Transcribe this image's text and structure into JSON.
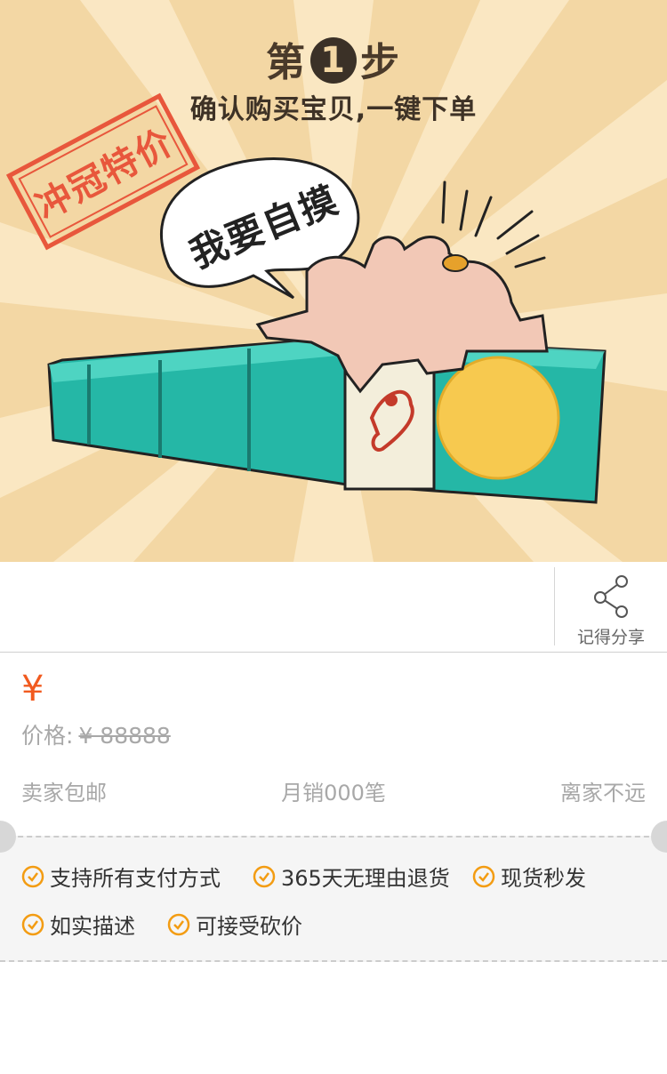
{
  "banner": {
    "step_prefix": "第",
    "step_number": "1",
    "step_suffix": "步",
    "subtitle": "确认购买宝贝,一键下单",
    "stamp_text": "冲冠特价",
    "bubble_text": "我要自摸"
  },
  "share": {
    "label": "记得分享",
    "icon": "share-icon"
  },
  "price": {
    "currency_symbol": "¥",
    "original_label": "价格:",
    "original_value": "¥ 88888"
  },
  "meta": {
    "shipping": "卖家包邮",
    "monthly_sales": "月销000笔",
    "distance": "离家不远"
  },
  "guarantees": {
    "items": [
      {
        "label": "支持所有支付方式",
        "icon": "check-circle-icon"
      },
      {
        "label": "365天无理由退货",
        "icon": "check-circle-icon"
      },
      {
        "label": "现货秒发",
        "icon": "check-circle-icon"
      },
      {
        "label": "如实描述",
        "icon": "check-circle-icon"
      },
      {
        "label": "可接受砍价",
        "icon": "check-circle-icon"
      }
    ]
  },
  "colors": {
    "accent": "#f15a1f",
    "check": "#f39c12",
    "stamp": "#e8573c",
    "banner_bg": "#f3d7a4",
    "tile_green": "#2ec4b0"
  }
}
